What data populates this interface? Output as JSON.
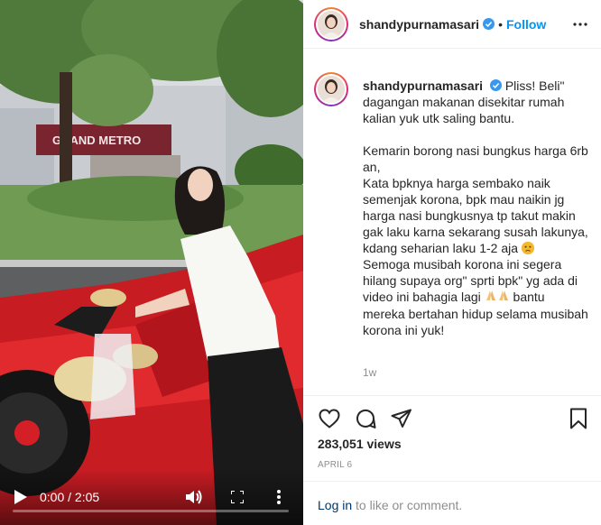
{
  "video": {
    "current_time": "0:00",
    "separator": " / ",
    "duration": "2:05",
    "progress_fraction": 0.0,
    "storefront_sign": "GRAND METRO"
  },
  "header": {
    "username": "shandypurnamasari",
    "dot": "•",
    "follow_label": "Follow"
  },
  "caption": {
    "username": "shandypurnamasari",
    "paragraphs": [
      "Pliss! Beli\" dagangan makanan disekitar rumah kalian yuk utk saling bantu.",
      "Kemarin borong nasi bungkus harga 6rb an,",
      "Kata bpknya harga sembako naik semenjak korona, bpk mau naikin jg harga nasi bungkusnya tp takut makin gak laku karna sekarang susah lakunya, kdang seharian laku 1-2 aja",
      "Semoga musibah korona ini segera hilang supaya org\" sprti bpk\" yg ada di video ini bahagia lagi",
      "bantu mereka bertahan hidup selama musibah korona ini yuk!"
    ],
    "time_ago": "1w"
  },
  "stats": {
    "views": "283,051 views",
    "date": "APRIL 6"
  },
  "login": {
    "link_label": "Log in",
    "rest": " to like or comment."
  },
  "icons": {
    "verified": "verified-badge-icon",
    "like": "heart-icon",
    "comment": "comment-icon",
    "share": "paper-plane-icon",
    "save": "bookmark-icon",
    "play": "play-icon",
    "volume": "volume-icon",
    "fullscreen": "fullscreen-icon",
    "more": "more-icon"
  },
  "colors": {
    "link_blue": "#0095f6",
    "login_blue": "#00376b",
    "car_red": "#d51f26",
    "muted_text": "#8e8e8e"
  }
}
